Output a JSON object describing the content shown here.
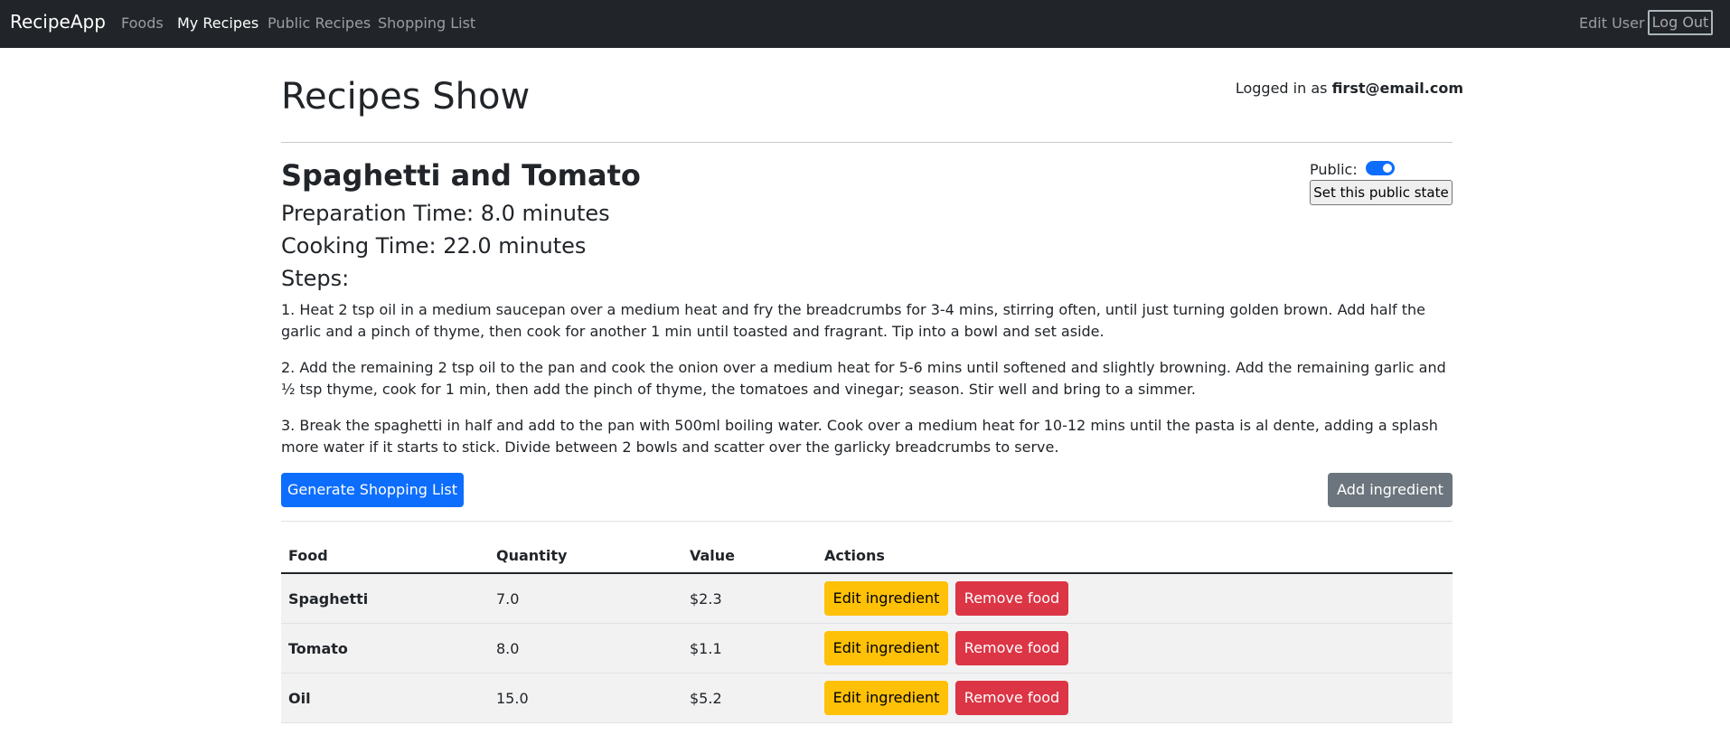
{
  "navbar": {
    "brand": "RecipeApp",
    "links": [
      "Foods",
      "My Recipes",
      "Public Recipes",
      "Shopping List"
    ],
    "active_link": "My Recipes",
    "edit_user": "Edit User",
    "log_out": "Log Out"
  },
  "header": {
    "title": "Recipes Show",
    "logged_in_prefix": "Logged in as",
    "user_email": "first@email.com"
  },
  "recipe": {
    "name": "Spaghetti and Tomato",
    "preparation_time": "Preparation Time: 8.0 minutes",
    "cooking_time": "Cooking Time: 22.0 minutes",
    "steps_heading": "Steps:",
    "steps": [
      "1. Heat 2 tsp oil in a medium saucepan over a medium heat and fry the breadcrumbs for 3-4 mins, stirring often, until just turning golden brown. Add half the garlic and a pinch of thyme, then cook for another 1 min until toasted and fragrant. Tip into a bowl and set aside.",
      "2. Add the remaining 2 tsp oil to the pan and cook the onion over a medium heat for 5-6 mins until softened and slightly browning. Add the remaining garlic and ½ tsp thyme, cook for 1 min, then add the pinch of thyme, the tomatoes and vinegar; season. Stir well and bring to a simmer.",
      "3. Break the spaghetti in half and add to the pan with 500ml boiling water. Cook over a medium heat for 10-12 mins until the pasta is al dente, adding a splash more water if it starts to stick. Divide between 2 bowls and scatter over the garlicky breadcrumbs to serve."
    ],
    "public_label": "Public:",
    "public_on": true,
    "set_public_label": "Set this public state"
  },
  "actions": {
    "generate_shopping_list": "Generate Shopping List",
    "add_ingredient": "Add ingredient"
  },
  "table": {
    "headers": [
      "Food",
      "Quantity",
      "Value",
      "Actions"
    ],
    "rows": [
      {
        "food": "Spaghetti",
        "quantity": "7.0",
        "value": "$2.3",
        "edit": "Edit ingredient",
        "remove": "Remove food"
      },
      {
        "food": "Tomato",
        "quantity": "8.0",
        "value": "$1.1",
        "edit": "Edit ingredient",
        "remove": "Remove food"
      },
      {
        "food": "Oil",
        "quantity": "15.0",
        "value": "$5.2",
        "edit": "Edit ingredient",
        "remove": "Remove food"
      }
    ]
  },
  "colors": {
    "navbar_bg": "#212529",
    "primary": "#0d6efd",
    "secondary": "#6c757d",
    "warning": "#ffc107",
    "danger": "#dc3545"
  }
}
